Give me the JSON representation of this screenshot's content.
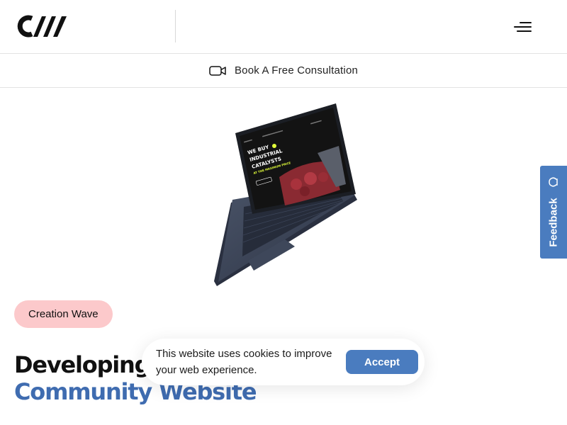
{
  "header": {
    "logo_icon": "brand-logo",
    "menu_icon": "hamburger-menu-icon"
  },
  "consultation": {
    "icon": "video-camera-icon",
    "label": "Book A Free Consultation"
  },
  "hero": {
    "image_icon": "laptop-mockup",
    "tag_label": "Creation Wave",
    "title_line1": "Developing",
    "title_line2": "Community Website"
  },
  "laptop_screen": {
    "headline": "WE BUY INDUSTRIAL CATALYSTS",
    "subheadline": "AT THE MAXIMUM PRICE"
  },
  "cookie_banner": {
    "text": "This website uses cookies to improve your web experience.",
    "accept_label": "Accept"
  },
  "feedback": {
    "label": "Feedback",
    "icon": "lightbulb-icon"
  },
  "colors": {
    "accent_blue": "#4a7cbf",
    "title_blue": "#3f6cb0",
    "tag_pink": "#fcc9cb",
    "laptop_body": "#3b4458",
    "screen_bg": "#131313",
    "screen_yellow": "#e3ff3a"
  }
}
